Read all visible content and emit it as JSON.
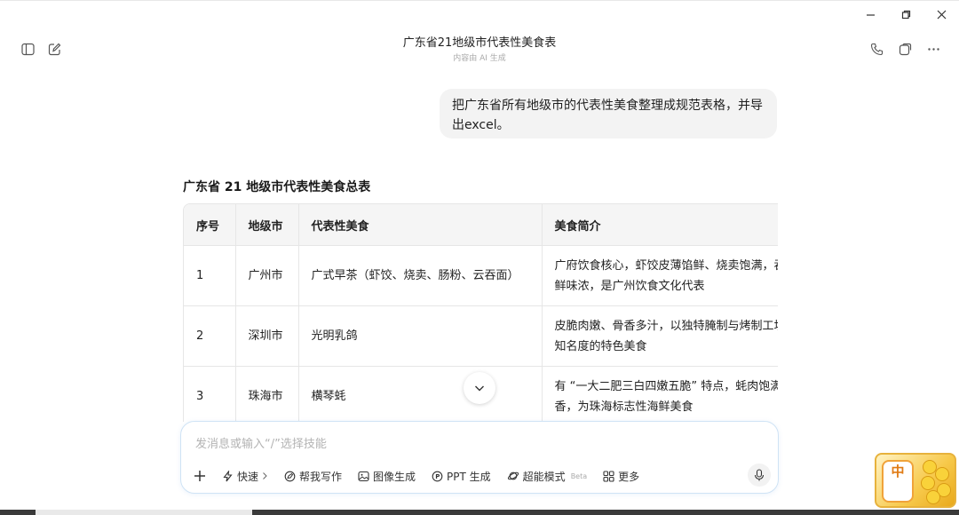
{
  "header": {
    "title": "广东省21地级市代表性美食表",
    "subtitle": "内容由 AI 生成"
  },
  "user_message": "把广东省所有地级市的代表性美食整理成规范表格，并导出excel。",
  "answer": {
    "heading": "广东省 21 地级市代表性美食总表",
    "columns": [
      "序号",
      "地级市",
      "代表性美食",
      "美食简介"
    ],
    "rows": [
      {
        "no": "1",
        "city": "广州市",
        "food": "广式早茶（虾饺、烧卖、肠粉、云吞面）",
        "desc": "广府饮食核心，虾饺皮薄馅鲜、烧卖饱满，吞面汤鲜味浓，是广州饮食文化代表"
      },
      {
        "no": "2",
        "city": "深圳市",
        "food": "光明乳鸽",
        "desc": "皮脆肉嫩、骨香多汁，以独特腌制与烤制工圳最具知名度的特色美食"
      },
      {
        "no": "3",
        "city": "珠海市",
        "food": "横琴蚝",
        "desc": "有 “一大二肥三白四嫩五脆” 特点，蚝肉饱满奶香，为珠海标志性海鲜美食"
      }
    ]
  },
  "composer": {
    "placeholder": "发消息或输入“/”选择技能",
    "tools": {
      "fast": "快速",
      "write": "帮我写作",
      "image": "图像生成",
      "ppt": "PPT 生成",
      "super": "超能模式",
      "beta": "Beta",
      "more": "更多"
    }
  },
  "ime": {
    "label": "中"
  }
}
